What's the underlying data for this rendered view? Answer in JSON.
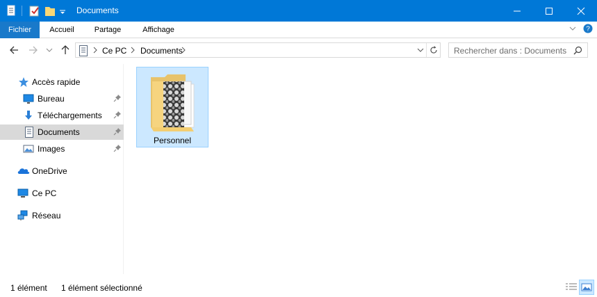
{
  "window": {
    "title": "Documents"
  },
  "ribbon": {
    "tabs": [
      "Fichier",
      "Accueil",
      "Partage",
      "Affichage"
    ]
  },
  "breadcrumb": {
    "items": [
      "Ce PC",
      "Documents"
    ]
  },
  "search": {
    "placeholder": "Rechercher dans : Documents"
  },
  "sidebar": {
    "quick_access": "Accès rapide",
    "pinned": [
      {
        "label": "Bureau",
        "icon": "desktop-icon"
      },
      {
        "label": "Téléchargements",
        "icon": "downloads-icon"
      },
      {
        "label": "Documents",
        "icon": "documents-icon",
        "selected": true
      },
      {
        "label": "Images",
        "icon": "pictures-icon"
      }
    ],
    "roots": [
      {
        "label": "OneDrive",
        "icon": "onedrive-icon"
      },
      {
        "label": "Ce PC",
        "icon": "this-pc-icon"
      },
      {
        "label": "Réseau",
        "icon": "network-icon"
      }
    ]
  },
  "content": {
    "items": [
      {
        "name": "Personnel",
        "selected": true
      }
    ]
  },
  "status": {
    "count": "1 élément",
    "selection": "1 élément sélectionné"
  },
  "colors": {
    "titlebar": "#0078d7",
    "selection": "#cce8ff",
    "file_tab": "#1979ca"
  }
}
